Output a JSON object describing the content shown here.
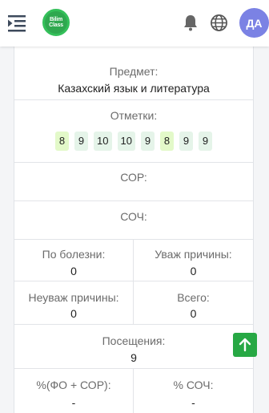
{
  "header": {
    "logo_line1": "Bilim",
    "logo_line2": "Class",
    "avatar_initials": "ДА"
  },
  "subject": {
    "label": "Предмет:",
    "value": "Казахский язык и литература"
  },
  "marks": {
    "label": "Отметки:",
    "items": [
      "8",
      "9",
      "10",
      "10",
      "9",
      "8",
      "9",
      "9"
    ]
  },
  "sor": {
    "label": "СОР:",
    "value": ""
  },
  "soch": {
    "label": "СОЧ:",
    "value": ""
  },
  "absences": {
    "illness_label": "По болезни:",
    "illness_value": "0",
    "excused_label": "Уваж причины:",
    "excused_value": "0",
    "unexcused_label": "Неуваж причины:",
    "unexcused_value": "0",
    "total_label": "Всего:",
    "total_value": "0"
  },
  "visits": {
    "label": "Посещения:",
    "value": "9"
  },
  "percent": {
    "fo_sor_label": "%(ФО + СОР):",
    "fo_sor_value": "-",
    "soch_label": "% СОЧ:",
    "soch_value": "-"
  },
  "colors": {
    "brand_green": "#2fa84f",
    "avatar_bg": "#7b82e4",
    "mark_high_bg": "#e3f9c9",
    "mark_bg": "#e5f4e9",
    "scroll_button": "#27a844"
  },
  "icons": {
    "menu": "menu-collapse-icon",
    "notifications": "bell-icon",
    "language": "globe-icon",
    "scroll_top": "arrow-up-icon"
  }
}
